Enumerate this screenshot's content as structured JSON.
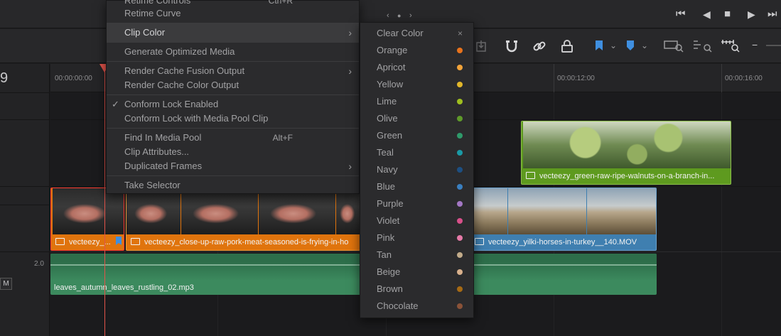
{
  "toolbar": {
    "nav_left": "‹",
    "nav_dot": "●",
    "nav_right": "›",
    "transport": [
      "⏮",
      "◀",
      "■",
      "▶",
      "⏭"
    ],
    "accent_blue": "#3f8fe0",
    "track_number": "9",
    "minus": "−"
  },
  "ruler": {
    "timecodes": [
      "00:00:00:00",
      "00:00:12:00",
      "00:00:16:00"
    ]
  },
  "tracks": {
    "audio_level": "2.0",
    "mute_label": "M"
  },
  "clips": {
    "meat_short": "vecteezy_...",
    "meat_long": "vecteezy_close-up-raw-pork-meat-seasoned-is-frying-in-ho",
    "horses": "vecteezy_yilki-horses-in-turkey__140.MOV",
    "walnuts": "vecteezy_green-raw-ripe-walnuts-on-a-branch-in...",
    "audio": "leaves_autumn_leaves_rustling_02.mp3",
    "colors": {
      "orange": "#e0740d",
      "blue": "#3f7fb0",
      "green": "#5e9a1f",
      "audio": "#3c8a5e"
    }
  },
  "context_menu": {
    "items": [
      {
        "label": "Retime Controls",
        "shortcut": "Ctrl+R"
      },
      {
        "label": "Retime Curve",
        "shortcut": ""
      },
      {
        "label": "Clip Color",
        "arrow": "›"
      },
      {
        "label": "Generate Optimized Media"
      },
      {
        "label": "Render Cache Fusion Output",
        "arrow": "›"
      },
      {
        "label": "Render Cache Color Output"
      },
      {
        "label": "Conform Lock Enabled",
        "check": "✓"
      },
      {
        "label": "Conform Lock with Media Pool Clip"
      },
      {
        "label": "Find In Media Pool",
        "shortcut": "Alt+F"
      },
      {
        "label": "Clip Attributes..."
      },
      {
        "label": "Duplicated Frames",
        "arrow": "›"
      },
      {
        "label": "Take Selector"
      }
    ]
  },
  "clip_color_menu": {
    "clear_label": "Clear Color",
    "clear_icon": "×",
    "colors": [
      {
        "label": "Orange",
        "color": "#e8731c"
      },
      {
        "label": "Apricot",
        "color": "#f2a33a"
      },
      {
        "label": "Yellow",
        "color": "#e2b72a"
      },
      {
        "label": "Lime",
        "color": "#9fbf1f"
      },
      {
        "label": "Olive",
        "color": "#5f9a2a"
      },
      {
        "label": "Green",
        "color": "#2f9a6a"
      },
      {
        "label": "Teal",
        "color": "#1a9aa6"
      },
      {
        "label": "Navy",
        "color": "#1d4f82"
      },
      {
        "label": "Blue",
        "color": "#3a7fc0"
      },
      {
        "label": "Purple",
        "color": "#a377c4"
      },
      {
        "label": "Violet",
        "color": "#d8508a"
      },
      {
        "label": "Pink",
        "color": "#e67aa8"
      },
      {
        "label": "Tan",
        "color": "#c2ab8a"
      },
      {
        "label": "Beige",
        "color": "#d8b08c"
      },
      {
        "label": "Brown",
        "color": "#a66a14"
      },
      {
        "label": "Chocolate",
        "color": "#8a5238"
      }
    ]
  }
}
